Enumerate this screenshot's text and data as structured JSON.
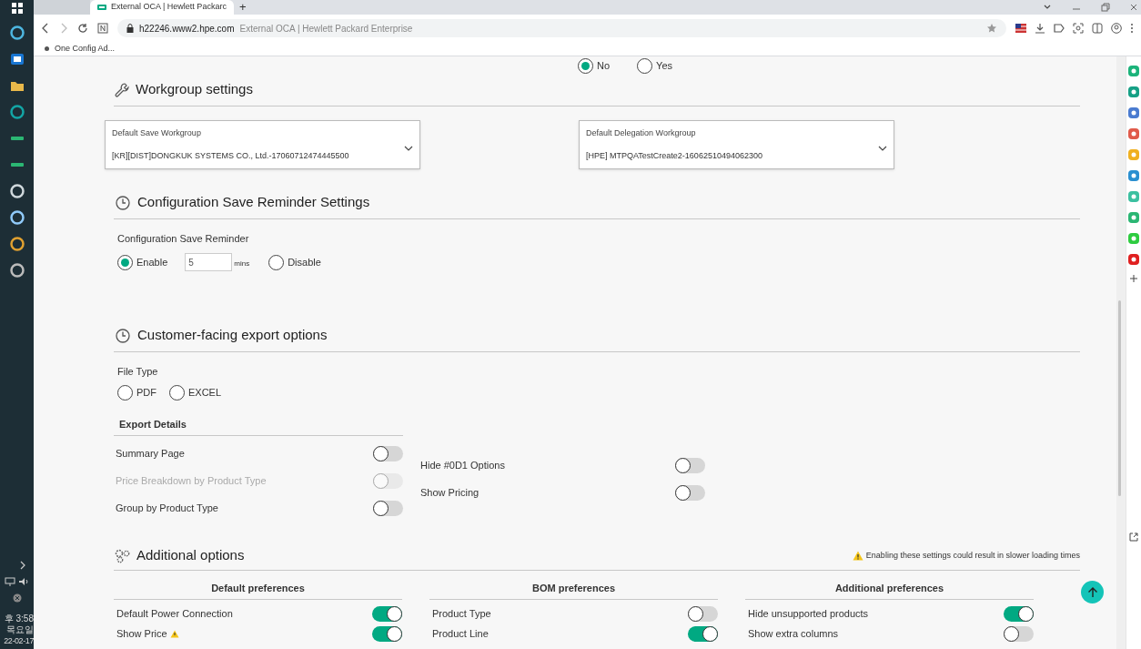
{
  "browser": {
    "tab_title": "External OCA | Hewlett Packarc",
    "url": "h22246.www2.hpe.com",
    "page_title": "External OCA | Hewlett Packard Enterprise",
    "new_tab": "+",
    "bookmarks": [
      "One Config Ad..."
    ]
  },
  "taskbar": {
    "clock": [
      "후 3:58",
      "목요일",
      "22-02-17"
    ]
  },
  "top_radios": [
    {
      "label": "No",
      "selected": true
    },
    {
      "label": "Yes",
      "selected": false
    }
  ],
  "workgroup": {
    "title": "Workgroup settings",
    "dropdowns": [
      {
        "label": "Default Save Workgroup",
        "value": "[KR][DIST]DONGKUK SYSTEMS CO., Ltd.-17060712474445500"
      },
      {
        "label": "Default Delegation Workgroup",
        "value": "[HPE] MTPQATestCreate2-16062510494062300"
      }
    ]
  },
  "reminder": {
    "title": "Configuration Save Reminder Settings",
    "label": "Configuration Save Reminder",
    "options": [
      {
        "label": "Enable",
        "selected": true
      },
      {
        "label": "Disable",
        "selected": false
      }
    ],
    "minutes": "5",
    "unit": "mins"
  },
  "export": {
    "title": "Customer-facing export options",
    "file_type_label": "File Type",
    "file_types": [
      {
        "label": "PDF",
        "selected": false
      },
      {
        "label": "EXCEL",
        "selected": false
      }
    ],
    "details_title": "Export Details",
    "left": [
      {
        "label": "Summary Page",
        "on": false,
        "disabled": false
      },
      {
        "label": "Price Breakdown by Product Type",
        "on": false,
        "disabled": true
      },
      {
        "label": "Group by Product Type",
        "on": false,
        "disabled": false
      }
    ],
    "right": [
      {
        "label": "Hide #0D1 Options",
        "on": false,
        "disabled": false
      },
      {
        "label": "Show Pricing",
        "on": false,
        "disabled": false
      }
    ]
  },
  "additional": {
    "title": "Additional options",
    "warning": "Enabling these settings could result in slower loading times",
    "columns": [
      {
        "title": "Default preferences",
        "items": [
          {
            "label": "Default Power Connection",
            "on": true,
            "warning": false
          },
          {
            "label": "Show Price",
            "on": true,
            "warning": true
          }
        ]
      },
      {
        "title": "BOM preferences",
        "items": [
          {
            "label": "Product Type",
            "on": false,
            "warning": false
          },
          {
            "label": "Product Line",
            "on": true,
            "warning": false
          }
        ]
      },
      {
        "title": "Additional preferences",
        "items": [
          {
            "label": "Hide unsupported products",
            "on": true,
            "warning": false
          },
          {
            "label": "Show extra columns",
            "on": false,
            "warning": false
          }
        ]
      }
    ]
  }
}
